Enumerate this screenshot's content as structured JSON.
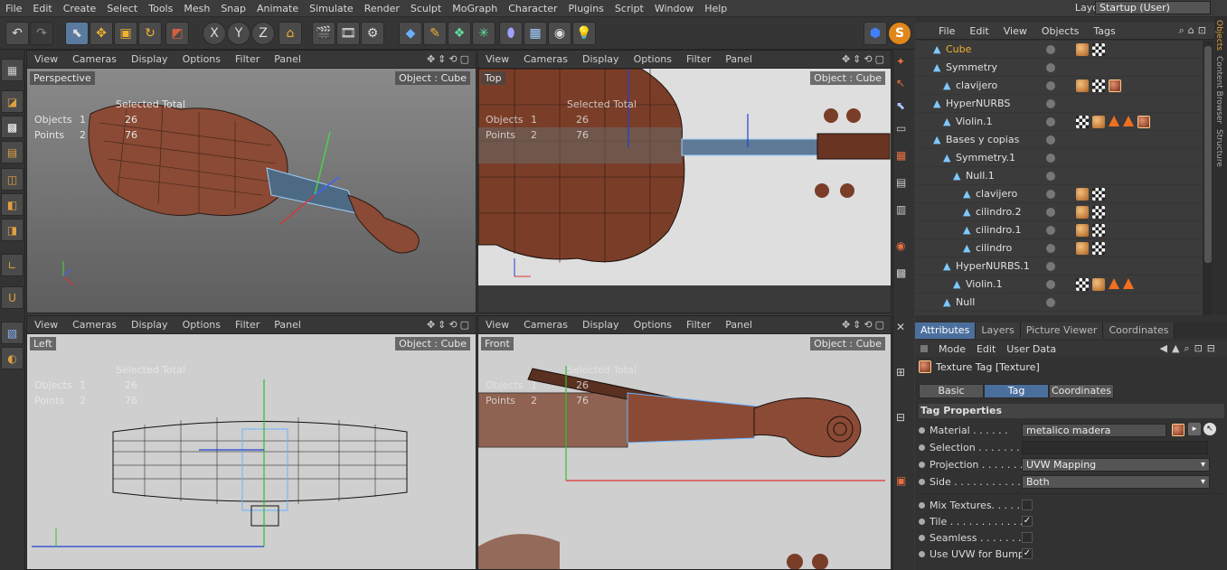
{
  "menubar": {
    "items": [
      "File",
      "Edit",
      "Create",
      "Select",
      "Tools",
      "Mesh",
      "Snap",
      "Animate",
      "Simulate",
      "Render",
      "Sculpt",
      "MoGraph",
      "Character",
      "Plugins",
      "Script",
      "Window",
      "Help"
    ],
    "layout_label": "Layout:",
    "layout_value": "Startup (User)"
  },
  "toolbar": {
    "axis_x": "X",
    "axis_y": "Y",
    "axis_z": "Z"
  },
  "viewport_menu": [
    "View",
    "Cameras",
    "Display",
    "Options",
    "Filter",
    "Panel"
  ],
  "viewports": [
    {
      "name": "Perspective",
      "object": "Object : Cube"
    },
    {
      "name": "Top",
      "object": "Object : Cube"
    },
    {
      "name": "Left",
      "object": "Object : Cube"
    },
    {
      "name": "Front",
      "object": "Object : Cube"
    }
  ],
  "hud": {
    "header": "Selected Total",
    "objects_label": "Objects",
    "objects_selected": "1",
    "objects_total": "26",
    "points_label": "Points",
    "points_selected": "2",
    "points_total": "76"
  },
  "object_manager": {
    "menu": [
      "File",
      "Edit",
      "View",
      "Objects",
      "Tags"
    ],
    "side_tabs": [
      "Objects",
      "Content Browser",
      "Structure"
    ],
    "rows": [
      {
        "name": "Cube",
        "indent": 0,
        "highlight": true
      },
      {
        "name": "Symmetry",
        "indent": 0
      },
      {
        "name": "clavijero",
        "indent": 1
      },
      {
        "name": "HyperNURBS",
        "indent": 0
      },
      {
        "name": "Violin.1",
        "indent": 1
      },
      {
        "name": "Bases y copias",
        "indent": 0
      },
      {
        "name": "Symmetry.1",
        "indent": 1
      },
      {
        "name": "Null.1",
        "indent": 2
      },
      {
        "name": "clavijero",
        "indent": 3
      },
      {
        "name": "cilindro.2",
        "indent": 3
      },
      {
        "name": "cilindro.1",
        "indent": 3
      },
      {
        "name": "cilindro",
        "indent": 3
      },
      {
        "name": "HyperNURBS.1",
        "indent": 1
      },
      {
        "name": "Violin.1",
        "indent": 2
      },
      {
        "name": "Null",
        "indent": 1
      }
    ]
  },
  "attributes": {
    "tabs": [
      "Attributes",
      "Layers",
      "Picture Viewer",
      "Coordinates"
    ],
    "menu": [
      "Mode",
      "Edit",
      "User Data"
    ],
    "title": "Texture Tag [Texture]",
    "subtabs": [
      "Basic",
      "Tag",
      "Coordinates"
    ],
    "section": "Tag Properties",
    "material_label": "Material . . . . . .",
    "material_value": "metalico madera",
    "selection_label": "Selection . . . . . . . .",
    "projection_label": "Projection . . . . . . .",
    "projection_value": "UVW Mapping",
    "side_label": "Side . . . . . . . . . . . .",
    "side_value": "Both",
    "mix_label": "Mix Textures. . . . . .",
    "tile_label": "Tile . . . . . . . . . . . . .",
    "seamless_label": "Seamless . . . . . . . .",
    "uvw_bump_label": "Use UVW for Bump",
    "mix_checked": false,
    "tile_checked": true,
    "seamless_checked": false,
    "uvw_bump_checked": true,
    "checkmark": "✓"
  }
}
